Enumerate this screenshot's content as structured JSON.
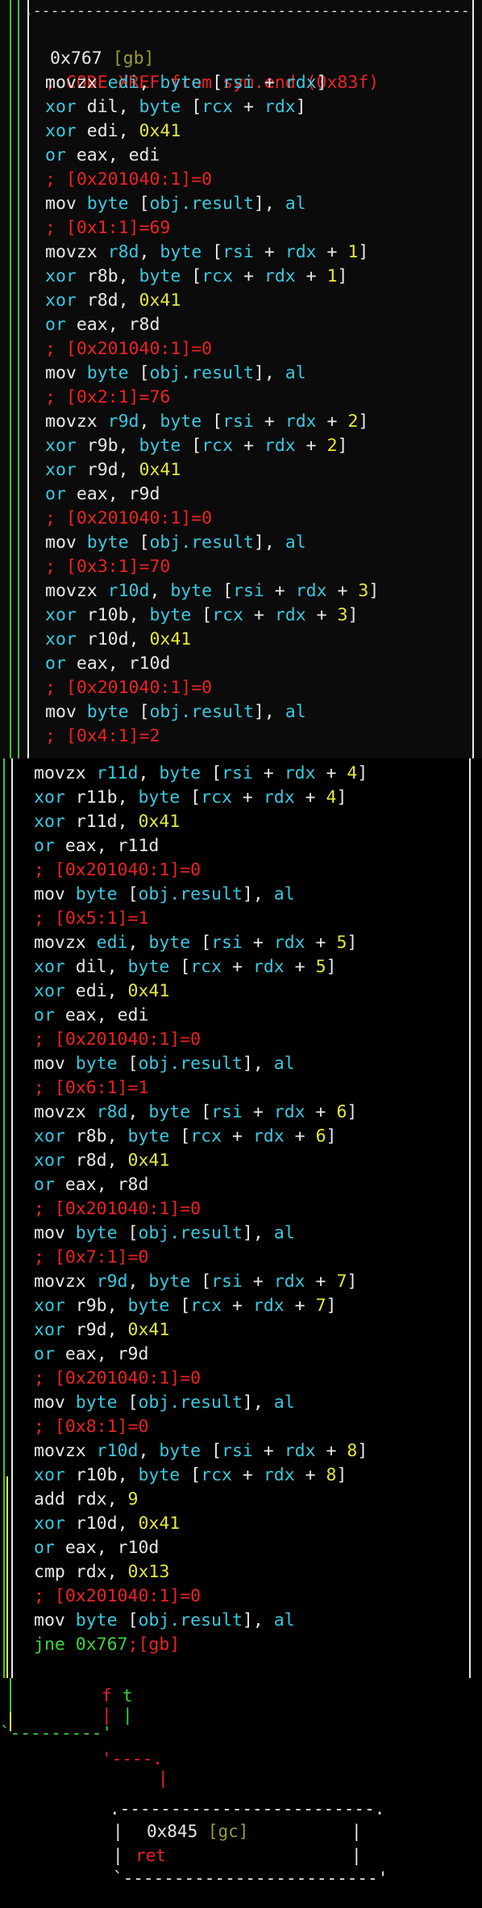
{
  "colors": {
    "instruction": "#e8e8e8",
    "register": "#38c9e0",
    "immediate": "#e8e83a",
    "comment": "#ee2222",
    "jump": "#3ed43e",
    "label_tag": "#9b9b3a",
    "frame_green": "#3ec43e",
    "frame_yellow": "#e8e83a",
    "frame_white": "#e8e8e8"
  },
  "block_top": {
    "address": "0x767",
    "tag": "[gb]",
    "xref_comment": "; CODE XREF from sym.end (0x83f)"
  },
  "lines_a": [
    [
      [
        "movzx ",
        "w"
      ],
      [
        "edi",
        "c"
      ],
      [
        ", ",
        "w"
      ],
      [
        "byte",
        "c"
      ],
      [
        " [",
        "w"
      ],
      [
        "rsi",
        "c"
      ],
      [
        " + ",
        "w"
      ],
      [
        "rdx",
        "c"
      ],
      [
        "]",
        "w"
      ]
    ],
    [
      [
        "xor ",
        "c"
      ],
      [
        "dil",
        "w"
      ],
      [
        ", ",
        "w"
      ],
      [
        "byte",
        "c"
      ],
      [
        " [",
        "w"
      ],
      [
        "rcx",
        "c"
      ],
      [
        " + ",
        "w"
      ],
      [
        "rdx",
        "c"
      ],
      [
        "]",
        "w"
      ]
    ],
    [
      [
        "xor ",
        "c"
      ],
      [
        "edi",
        "w"
      ],
      [
        ", ",
        "w"
      ],
      [
        "0x41",
        "y"
      ]
    ],
    [
      [
        "or ",
        "c"
      ],
      [
        "eax",
        "w"
      ],
      [
        ", ",
        "w"
      ],
      [
        "edi",
        "w"
      ]
    ],
    [
      [
        "; [0x201040:1]=0",
        "r"
      ]
    ],
    [
      [
        "mov ",
        "w"
      ],
      [
        "byte",
        "c"
      ],
      [
        " [",
        "w"
      ],
      [
        "obj.result",
        "c"
      ],
      [
        "], ",
        "w"
      ],
      [
        "al",
        "c"
      ]
    ],
    [
      [
        "; [0x1:1]=69",
        "r"
      ]
    ],
    [
      [
        "movzx ",
        "w"
      ],
      [
        "r8d",
        "c"
      ],
      [
        ", ",
        "w"
      ],
      [
        "byte",
        "c"
      ],
      [
        " [",
        "w"
      ],
      [
        "rsi",
        "c"
      ],
      [
        " + ",
        "w"
      ],
      [
        "rdx",
        "c"
      ],
      [
        " + ",
        "w"
      ],
      [
        "1",
        "y"
      ],
      [
        "]",
        "w"
      ]
    ],
    [
      [
        "xor ",
        "c"
      ],
      [
        "r8b",
        "w"
      ],
      [
        ", ",
        "w"
      ],
      [
        "byte",
        "c"
      ],
      [
        " [",
        "w"
      ],
      [
        "rcx",
        "c"
      ],
      [
        " + ",
        "w"
      ],
      [
        "rdx",
        "c"
      ],
      [
        " + ",
        "w"
      ],
      [
        "1",
        "y"
      ],
      [
        "]",
        "w"
      ]
    ],
    [
      [
        "xor ",
        "c"
      ],
      [
        "r8d",
        "w"
      ],
      [
        ", ",
        "w"
      ],
      [
        "0x41",
        "y"
      ]
    ],
    [
      [
        "or ",
        "c"
      ],
      [
        "eax",
        "w"
      ],
      [
        ", ",
        "w"
      ],
      [
        "r8d",
        "w"
      ]
    ],
    [
      [
        "; [0x201040:1]=0",
        "r"
      ]
    ],
    [
      [
        "mov ",
        "w"
      ],
      [
        "byte",
        "c"
      ],
      [
        " [",
        "w"
      ],
      [
        "obj.result",
        "c"
      ],
      [
        "], ",
        "w"
      ],
      [
        "al",
        "c"
      ]
    ],
    [
      [
        "; [0x2:1]=76",
        "r"
      ]
    ],
    [
      [
        "movzx ",
        "w"
      ],
      [
        "r9d",
        "c"
      ],
      [
        ", ",
        "w"
      ],
      [
        "byte",
        "c"
      ],
      [
        " [",
        "w"
      ],
      [
        "rsi",
        "c"
      ],
      [
        " + ",
        "w"
      ],
      [
        "rdx",
        "c"
      ],
      [
        " + ",
        "w"
      ],
      [
        "2",
        "y"
      ],
      [
        "]",
        "w"
      ]
    ],
    [
      [
        "xor ",
        "c"
      ],
      [
        "r9b",
        "w"
      ],
      [
        ", ",
        "w"
      ],
      [
        "byte",
        "c"
      ],
      [
        " [",
        "w"
      ],
      [
        "rcx",
        "c"
      ],
      [
        " + ",
        "w"
      ],
      [
        "rdx",
        "c"
      ],
      [
        " + ",
        "w"
      ],
      [
        "2",
        "y"
      ],
      [
        "]",
        "w"
      ]
    ],
    [
      [
        "xor ",
        "c"
      ],
      [
        "r9d",
        "w"
      ],
      [
        ", ",
        "w"
      ],
      [
        "0x41",
        "y"
      ]
    ],
    [
      [
        "or ",
        "c"
      ],
      [
        "eax",
        "w"
      ],
      [
        ", ",
        "w"
      ],
      [
        "r9d",
        "w"
      ]
    ],
    [
      [
        "; [0x201040:1]=0",
        "r"
      ]
    ],
    [
      [
        "mov ",
        "w"
      ],
      [
        "byte",
        "c"
      ],
      [
        " [",
        "w"
      ],
      [
        "obj.result",
        "c"
      ],
      [
        "], ",
        "w"
      ],
      [
        "al",
        "c"
      ]
    ],
    [
      [
        "; [0x3:1]=70",
        "r"
      ]
    ],
    [
      [
        "movzx ",
        "w"
      ],
      [
        "r10d",
        "c"
      ],
      [
        ", ",
        "w"
      ],
      [
        "byte",
        "c"
      ],
      [
        " [",
        "w"
      ],
      [
        "rsi",
        "c"
      ],
      [
        " + ",
        "w"
      ],
      [
        "rdx",
        "c"
      ],
      [
        " + ",
        "w"
      ],
      [
        "3",
        "y"
      ],
      [
        "]",
        "w"
      ]
    ],
    [
      [
        "xor ",
        "c"
      ],
      [
        "r10b",
        "w"
      ],
      [
        ", ",
        "w"
      ],
      [
        "byte",
        "c"
      ],
      [
        " [",
        "w"
      ],
      [
        "rcx",
        "c"
      ],
      [
        " + ",
        "w"
      ],
      [
        "rdx",
        "c"
      ],
      [
        " + ",
        "w"
      ],
      [
        "3",
        "y"
      ],
      [
        "]",
        "w"
      ]
    ],
    [
      [
        "xor ",
        "c"
      ],
      [
        "r10d",
        "w"
      ],
      [
        ", ",
        "w"
      ],
      [
        "0x41",
        "y"
      ]
    ],
    [
      [
        "or ",
        "c"
      ],
      [
        "eax",
        "w"
      ],
      [
        ", ",
        "w"
      ],
      [
        "r10d",
        "w"
      ]
    ],
    [
      [
        "; [0x201040:1]=0",
        "r"
      ]
    ],
    [
      [
        "mov ",
        "w"
      ],
      [
        "byte",
        "c"
      ],
      [
        " [",
        "w"
      ],
      [
        "obj.result",
        "c"
      ],
      [
        "], ",
        "w"
      ],
      [
        "al",
        "c"
      ]
    ],
    [
      [
        "; [0x4:1]=2",
        "r"
      ]
    ]
  ],
  "lines_b": [
    [
      [
        "movzx ",
        "w"
      ],
      [
        "r11d",
        "c"
      ],
      [
        ", ",
        "w"
      ],
      [
        "byte",
        "c"
      ],
      [
        " [",
        "w"
      ],
      [
        "rsi",
        "c"
      ],
      [
        " + ",
        "w"
      ],
      [
        "rdx",
        "c"
      ],
      [
        " + ",
        "w"
      ],
      [
        "4",
        "y"
      ],
      [
        "]",
        "w"
      ]
    ],
    [
      [
        "xor ",
        "c"
      ],
      [
        "r11b",
        "w"
      ],
      [
        ", ",
        "w"
      ],
      [
        "byte",
        "c"
      ],
      [
        " [",
        "w"
      ],
      [
        "rcx",
        "c"
      ],
      [
        " + ",
        "w"
      ],
      [
        "rdx",
        "c"
      ],
      [
        " + ",
        "w"
      ],
      [
        "4",
        "y"
      ],
      [
        "]",
        "w"
      ]
    ],
    [
      [
        "xor ",
        "c"
      ],
      [
        "r11d",
        "w"
      ],
      [
        ", ",
        "w"
      ],
      [
        "0x41",
        "y"
      ]
    ],
    [
      [
        "or ",
        "c"
      ],
      [
        "eax",
        "w"
      ],
      [
        ", ",
        "w"
      ],
      [
        "r11d",
        "w"
      ]
    ],
    [
      [
        "; [0x201040:1]=0",
        "r"
      ]
    ],
    [
      [
        "mov ",
        "w"
      ],
      [
        "byte",
        "c"
      ],
      [
        " [",
        "w"
      ],
      [
        "obj.result",
        "c"
      ],
      [
        "], ",
        "w"
      ],
      [
        "al",
        "c"
      ]
    ],
    [
      [
        "; [0x5:1]=1",
        "r"
      ]
    ],
    [
      [
        "movzx ",
        "w"
      ],
      [
        "edi",
        "c"
      ],
      [
        ", ",
        "w"
      ],
      [
        "byte",
        "c"
      ],
      [
        " [",
        "w"
      ],
      [
        "rsi",
        "c"
      ],
      [
        " + ",
        "w"
      ],
      [
        "rdx",
        "c"
      ],
      [
        " + ",
        "w"
      ],
      [
        "5",
        "y"
      ],
      [
        "]",
        "w"
      ]
    ],
    [
      [
        "xor ",
        "c"
      ],
      [
        "dil",
        "w"
      ],
      [
        ", ",
        "w"
      ],
      [
        "byte",
        "c"
      ],
      [
        " [",
        "w"
      ],
      [
        "rcx",
        "c"
      ],
      [
        " + ",
        "w"
      ],
      [
        "rdx",
        "c"
      ],
      [
        " + ",
        "w"
      ],
      [
        "5",
        "y"
      ],
      [
        "]",
        "w"
      ]
    ],
    [
      [
        "xor ",
        "c"
      ],
      [
        "edi",
        "w"
      ],
      [
        ", ",
        "w"
      ],
      [
        "0x41",
        "y"
      ]
    ],
    [
      [
        "or ",
        "c"
      ],
      [
        "eax",
        "w"
      ],
      [
        ", ",
        "w"
      ],
      [
        "edi",
        "w"
      ]
    ],
    [
      [
        "; [0x201040:1]=0",
        "r"
      ]
    ],
    [
      [
        "mov ",
        "w"
      ],
      [
        "byte",
        "c"
      ],
      [
        " [",
        "w"
      ],
      [
        "obj.result",
        "c"
      ],
      [
        "], ",
        "w"
      ],
      [
        "al",
        "c"
      ]
    ],
    [
      [
        "; [0x6:1]=1",
        "r"
      ]
    ],
    [
      [
        "movzx ",
        "w"
      ],
      [
        "r8d",
        "c"
      ],
      [
        ", ",
        "w"
      ],
      [
        "byte",
        "c"
      ],
      [
        " [",
        "w"
      ],
      [
        "rsi",
        "c"
      ],
      [
        " + ",
        "w"
      ],
      [
        "rdx",
        "c"
      ],
      [
        " + ",
        "w"
      ],
      [
        "6",
        "y"
      ],
      [
        "]",
        "w"
      ]
    ],
    [
      [
        "xor ",
        "c"
      ],
      [
        "r8b",
        "w"
      ],
      [
        ", ",
        "w"
      ],
      [
        "byte",
        "c"
      ],
      [
        " [",
        "w"
      ],
      [
        "rcx",
        "c"
      ],
      [
        " + ",
        "w"
      ],
      [
        "rdx",
        "c"
      ],
      [
        " + ",
        "w"
      ],
      [
        "6",
        "y"
      ],
      [
        "]",
        "w"
      ]
    ],
    [
      [
        "xor ",
        "c"
      ],
      [
        "r8d",
        "w"
      ],
      [
        ", ",
        "w"
      ],
      [
        "0x41",
        "y"
      ]
    ],
    [
      [
        "or ",
        "c"
      ],
      [
        "eax",
        "w"
      ],
      [
        ", ",
        "w"
      ],
      [
        "r8d",
        "w"
      ]
    ],
    [
      [
        "; [0x201040:1]=0",
        "r"
      ]
    ],
    [
      [
        "mov ",
        "w"
      ],
      [
        "byte",
        "c"
      ],
      [
        " [",
        "w"
      ],
      [
        "obj.result",
        "c"
      ],
      [
        "], ",
        "w"
      ],
      [
        "al",
        "c"
      ]
    ],
    [
      [
        "; [0x7:1]=0",
        "r"
      ]
    ],
    [
      [
        "movzx ",
        "w"
      ],
      [
        "r9d",
        "c"
      ],
      [
        ", ",
        "w"
      ],
      [
        "byte",
        "c"
      ],
      [
        " [",
        "w"
      ],
      [
        "rsi",
        "c"
      ],
      [
        " + ",
        "w"
      ],
      [
        "rdx",
        "c"
      ],
      [
        " + ",
        "w"
      ],
      [
        "7",
        "y"
      ],
      [
        "]",
        "w"
      ]
    ],
    [
      [
        "xor ",
        "c"
      ],
      [
        "r9b",
        "w"
      ],
      [
        ", ",
        "w"
      ],
      [
        "byte",
        "c"
      ],
      [
        " [",
        "w"
      ],
      [
        "rcx",
        "c"
      ],
      [
        " + ",
        "w"
      ],
      [
        "rdx",
        "c"
      ],
      [
        " + ",
        "w"
      ],
      [
        "7",
        "y"
      ],
      [
        "]",
        "w"
      ]
    ],
    [
      [
        "xor ",
        "c"
      ],
      [
        "r9d",
        "w"
      ],
      [
        ", ",
        "w"
      ],
      [
        "0x41",
        "y"
      ]
    ],
    [
      [
        "or ",
        "c"
      ],
      [
        "eax",
        "w"
      ],
      [
        ", ",
        "w"
      ],
      [
        "r9d",
        "w"
      ]
    ],
    [
      [
        "; [0x201040:1]=0",
        "r"
      ]
    ],
    [
      [
        "mov ",
        "w"
      ],
      [
        "byte",
        "c"
      ],
      [
        " [",
        "w"
      ],
      [
        "obj.result",
        "c"
      ],
      [
        "], ",
        "w"
      ],
      [
        "al",
        "c"
      ]
    ],
    [
      [
        "; [0x8:1]=0",
        "r"
      ]
    ],
    [
      [
        "movzx ",
        "w"
      ],
      [
        "r10d",
        "c"
      ],
      [
        ", ",
        "w"
      ],
      [
        "byte",
        "c"
      ],
      [
        " [",
        "w"
      ],
      [
        "rsi",
        "c"
      ],
      [
        " + ",
        "w"
      ],
      [
        "rdx",
        "c"
      ],
      [
        " + ",
        "w"
      ],
      [
        "8",
        "y"
      ],
      [
        "]",
        "w"
      ]
    ],
    [
      [
        "xor ",
        "c"
      ],
      [
        "r10b",
        "w"
      ],
      [
        ", ",
        "w"
      ],
      [
        "byte",
        "c"
      ],
      [
        " [",
        "w"
      ],
      [
        "rcx",
        "c"
      ],
      [
        " + ",
        "w"
      ],
      [
        "rdx",
        "c"
      ],
      [
        " + ",
        "w"
      ],
      [
        "8",
        "y"
      ],
      [
        "]",
        "w"
      ]
    ],
    [
      [
        "add ",
        "w"
      ],
      [
        "rdx",
        "w"
      ],
      [
        ", ",
        "w"
      ],
      [
        "9",
        "y"
      ]
    ],
    [
      [
        "xor ",
        "c"
      ],
      [
        "r10d",
        "w"
      ],
      [
        ", ",
        "w"
      ],
      [
        "0x41",
        "y"
      ]
    ],
    [
      [
        "or ",
        "c"
      ],
      [
        "eax",
        "w"
      ],
      [
        ", ",
        "w"
      ],
      [
        "r10d",
        "w"
      ]
    ],
    [
      [
        "cmp ",
        "w"
      ],
      [
        "rdx",
        "w"
      ],
      [
        ", ",
        "w"
      ],
      [
        "0x13",
        "y"
      ]
    ],
    [
      [
        "; [0x201040:1]=0",
        "r"
      ]
    ],
    [
      [
        "mov ",
        "w"
      ],
      [
        "byte",
        "c"
      ],
      [
        " [",
        "w"
      ],
      [
        "obj.result",
        "c"
      ],
      [
        "], ",
        "w"
      ],
      [
        "al",
        "c"
      ]
    ],
    [
      [
        "jne ",
        "g"
      ],
      [
        "0x767",
        "g"
      ],
      [
        ";[gb]",
        "r"
      ]
    ]
  ],
  "branch": {
    "false_label": "f",
    "true_label": "t",
    "bar_glyph": "|",
    "connector": "'----.",
    "dashes_left": "`---------'"
  },
  "block_bottom": {
    "address": "0x845",
    "tag": "[gc]",
    "instruction": "ret"
  },
  "frame_border": ".----------------------------------------------------------------------------."
}
